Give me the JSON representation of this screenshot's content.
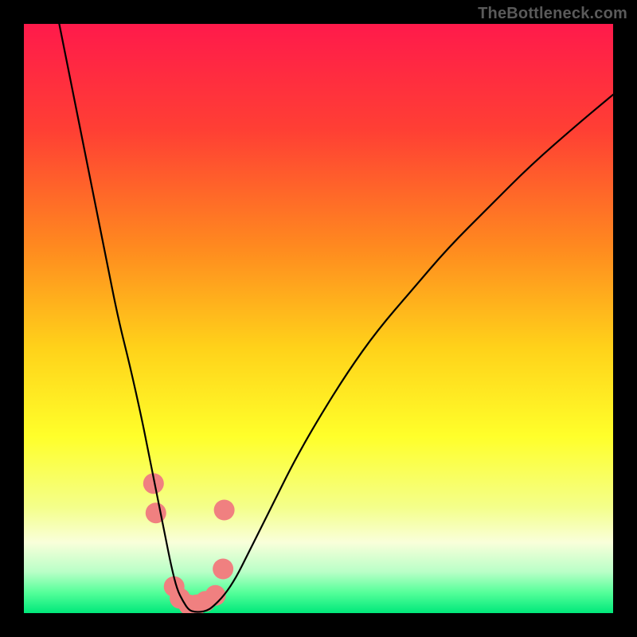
{
  "watermark": "TheBottleneck.com",
  "chart_data": {
    "type": "line",
    "title": "",
    "xlabel": "",
    "ylabel": "",
    "xlim": [
      0,
      100
    ],
    "ylim": [
      0,
      100
    ],
    "grid": false,
    "legend": false,
    "gradient_stops": [
      {
        "offset": 0.0,
        "color": "#ff1a4b"
      },
      {
        "offset": 0.18,
        "color": "#ff3f34"
      },
      {
        "offset": 0.38,
        "color": "#ff8a1f"
      },
      {
        "offset": 0.55,
        "color": "#ffd21a"
      },
      {
        "offset": 0.7,
        "color": "#ffff2a"
      },
      {
        "offset": 0.82,
        "color": "#f4ff8a"
      },
      {
        "offset": 0.88,
        "color": "#f9ffda"
      },
      {
        "offset": 0.93,
        "color": "#b9ffc7"
      },
      {
        "offset": 0.965,
        "color": "#55ff9a"
      },
      {
        "offset": 1.0,
        "color": "#00e87a"
      }
    ],
    "series": [
      {
        "name": "bottleneck-curve",
        "stroke": "#000000",
        "stroke_width": 2.2,
        "x": [
          6,
          8,
          10,
          12,
          14,
          16,
          18,
          20,
          21,
          22,
          23,
          24,
          25,
          26,
          27,
          28,
          29,
          30,
          31,
          32,
          34,
          36,
          38,
          40,
          43,
          46,
          50,
          55,
          60,
          66,
          72,
          79,
          86,
          94,
          100
        ],
        "y": [
          100,
          90,
          80,
          70,
          60,
          50,
          42,
          33,
          28,
          23,
          18,
          13,
          8,
          4,
          2,
          0.5,
          0.2,
          0.2,
          0.4,
          1,
          3,
          6,
          10,
          14,
          20,
          26,
          33,
          41,
          48,
          55,
          62,
          69,
          76,
          83,
          88
        ]
      }
    ],
    "markers": {
      "name": "highlight-dots",
      "fill": "#f08080",
      "radius": 13,
      "points": [
        {
          "x": 22.0,
          "y": 22
        },
        {
          "x": 22.4,
          "y": 17
        },
        {
          "x": 25.5,
          "y": 4.5
        },
        {
          "x": 26.5,
          "y": 2.5
        },
        {
          "x": 28.0,
          "y": 1.4
        },
        {
          "x": 29.3,
          "y": 1.4
        },
        {
          "x": 30.8,
          "y": 2.0
        },
        {
          "x": 32.5,
          "y": 3.0
        },
        {
          "x": 33.8,
          "y": 7.5
        },
        {
          "x": 34.0,
          "y": 17.5
        }
      ]
    }
  }
}
